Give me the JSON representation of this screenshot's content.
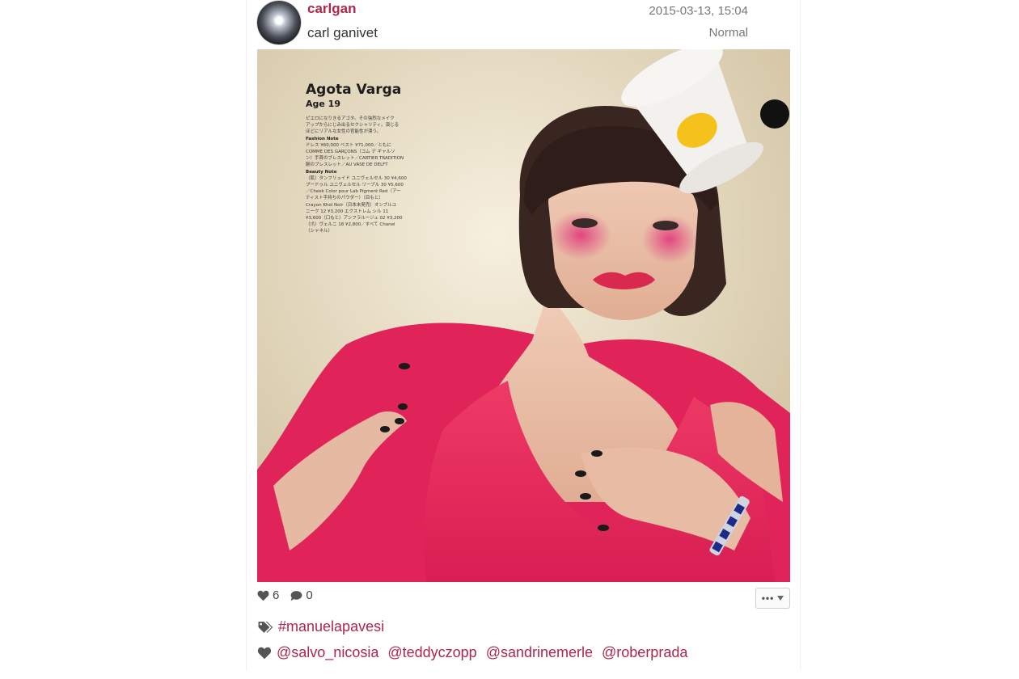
{
  "post": {
    "username": "carlgan",
    "fullname": "carl ganivet",
    "timestamp": "2015-03-13, 15:04",
    "filter": "Normal"
  },
  "photo": {
    "name": "Agota Varga",
    "age": "Age 19",
    "text_lines": [
      "ピエロになりきるアゴタ。その強烈なメイク",
      "アップからにじみ出るセクシャリティ。演じる",
      "ほどにリアルな女性の官能性が漂う。"
    ],
    "fashion_note_heading": "Fashion Note",
    "fashion_lines": [
      "ドレス ¥60,000  ベスト ¥71,000／ともに",
      "COMME DES GARÇONS（コム デ ギャルソ",
      "ン）手首のブレスレット／CARTIER TRADITION",
      "腕のブレスレット／AU VASE DE DELFT"
    ],
    "beauty_note_heading": "Beauty Note",
    "beauty_lines": [
      "（肌）タンフリュイド ユニヴェルセル 30 ¥4,600",
      "プードゥル ユニヴェルセル リーブル 30 ¥5,600",
      "／Cheek Color pour Lab Pigment Red（アー",
      "ティスト手持ちのパウダー）（目もと）",
      "Crayon Khol Noir（日本未発売）オンブルユ",
      "ニーク 12 ¥3,200  エクストレム シル 11",
      "¥3,600（口もと）アンフラルージュ 02 ¥3,200",
      "（爪）ヴェルニ 18 ¥2,800／すべて Chanel",
      "（シャネル）"
    ]
  },
  "stats": {
    "likes": "6",
    "comments": "0"
  },
  "more_button": {
    "label": "•••",
    "icon": "caret-down-icon"
  },
  "tags": [
    "#manuelapavesi"
  ],
  "tagged_users": [
    "@salvo_nicosia",
    "@teddyczopp",
    "@sandrinemerle",
    "@roberprada"
  ],
  "colors": {
    "accent": "#b0264a",
    "dress": "#e8285c",
    "icon": "#555555"
  }
}
